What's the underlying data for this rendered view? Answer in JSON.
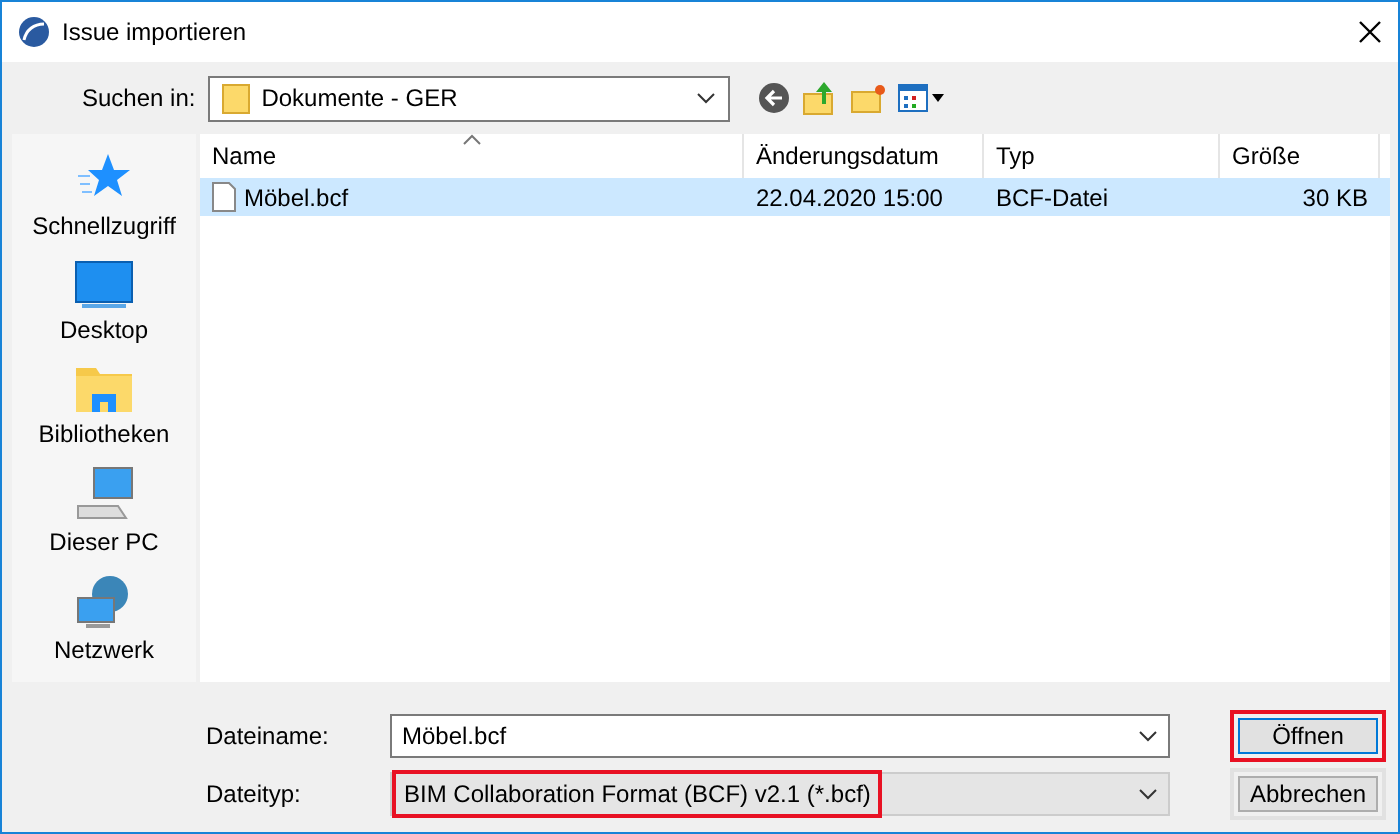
{
  "window": {
    "title": "Issue importieren"
  },
  "look_in": {
    "label": "Suchen in:",
    "value": "Dokumente - GER"
  },
  "sidebar": {
    "items": [
      {
        "label": "Schnellzugriff",
        "kind": "star"
      },
      {
        "label": "Desktop",
        "kind": "desktop"
      },
      {
        "label": "Bibliotheken",
        "kind": "library"
      },
      {
        "label": "Dieser PC",
        "kind": "pc"
      },
      {
        "label": "Netzwerk",
        "kind": "network"
      }
    ]
  },
  "table": {
    "columns": [
      "Name",
      "Änderungsdatum",
      "Typ",
      "Größe"
    ],
    "rows": [
      {
        "name": "Möbel.bcf",
        "date": "22.04.2020 15:00",
        "type": "BCF-Datei",
        "size": "30 KB",
        "selected": true
      }
    ]
  },
  "file_name": {
    "label": "Dateiname:",
    "value": "Möbel.bcf"
  },
  "file_type": {
    "label": "Dateityp:",
    "value": "BIM Collaboration Format (BCF) v2.1  (*.bcf)",
    "highlighted": true
  },
  "buttons": [
    {
      "label": "Öffnen",
      "default": true,
      "highlighted": true
    },
    {
      "label": "Abbrechen",
      "default": false,
      "highlighted": false
    }
  ]
}
